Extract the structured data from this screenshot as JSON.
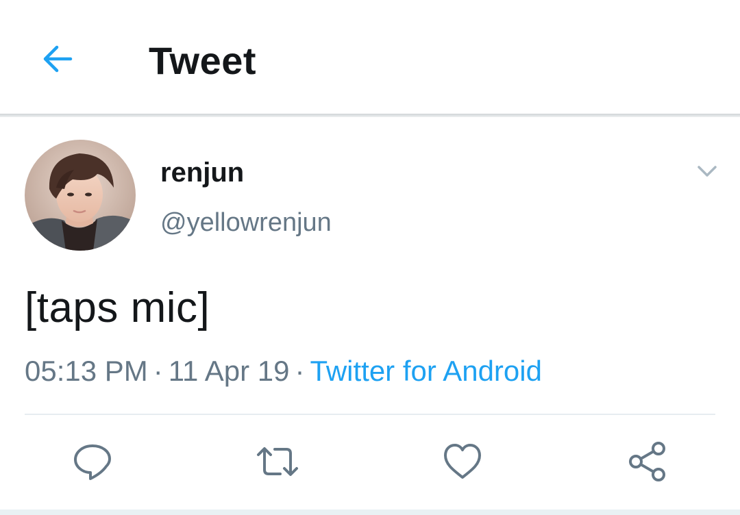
{
  "header": {
    "title": "Tweet",
    "back_icon": "arrow-left-icon",
    "accent_color": "#1da1f2"
  },
  "tweet": {
    "author_name": "renjun",
    "author_handle": "@yellowrenjun",
    "text": "[taps mic]",
    "time": "05:13 PM",
    "date": "11 Apr 19",
    "source": "Twitter for Android",
    "separator": "·",
    "menu_icon": "chevron-down-icon"
  },
  "actions": [
    {
      "name": "reply",
      "icon": "reply-icon"
    },
    {
      "name": "retweet",
      "icon": "retweet-icon"
    },
    {
      "name": "like",
      "icon": "heart-icon"
    },
    {
      "name": "share",
      "icon": "share-icon"
    }
  ],
  "colors": {
    "text_primary": "#14171a",
    "text_secondary": "#657786",
    "link": "#1da1f2",
    "divider": "#e6ecf0"
  }
}
